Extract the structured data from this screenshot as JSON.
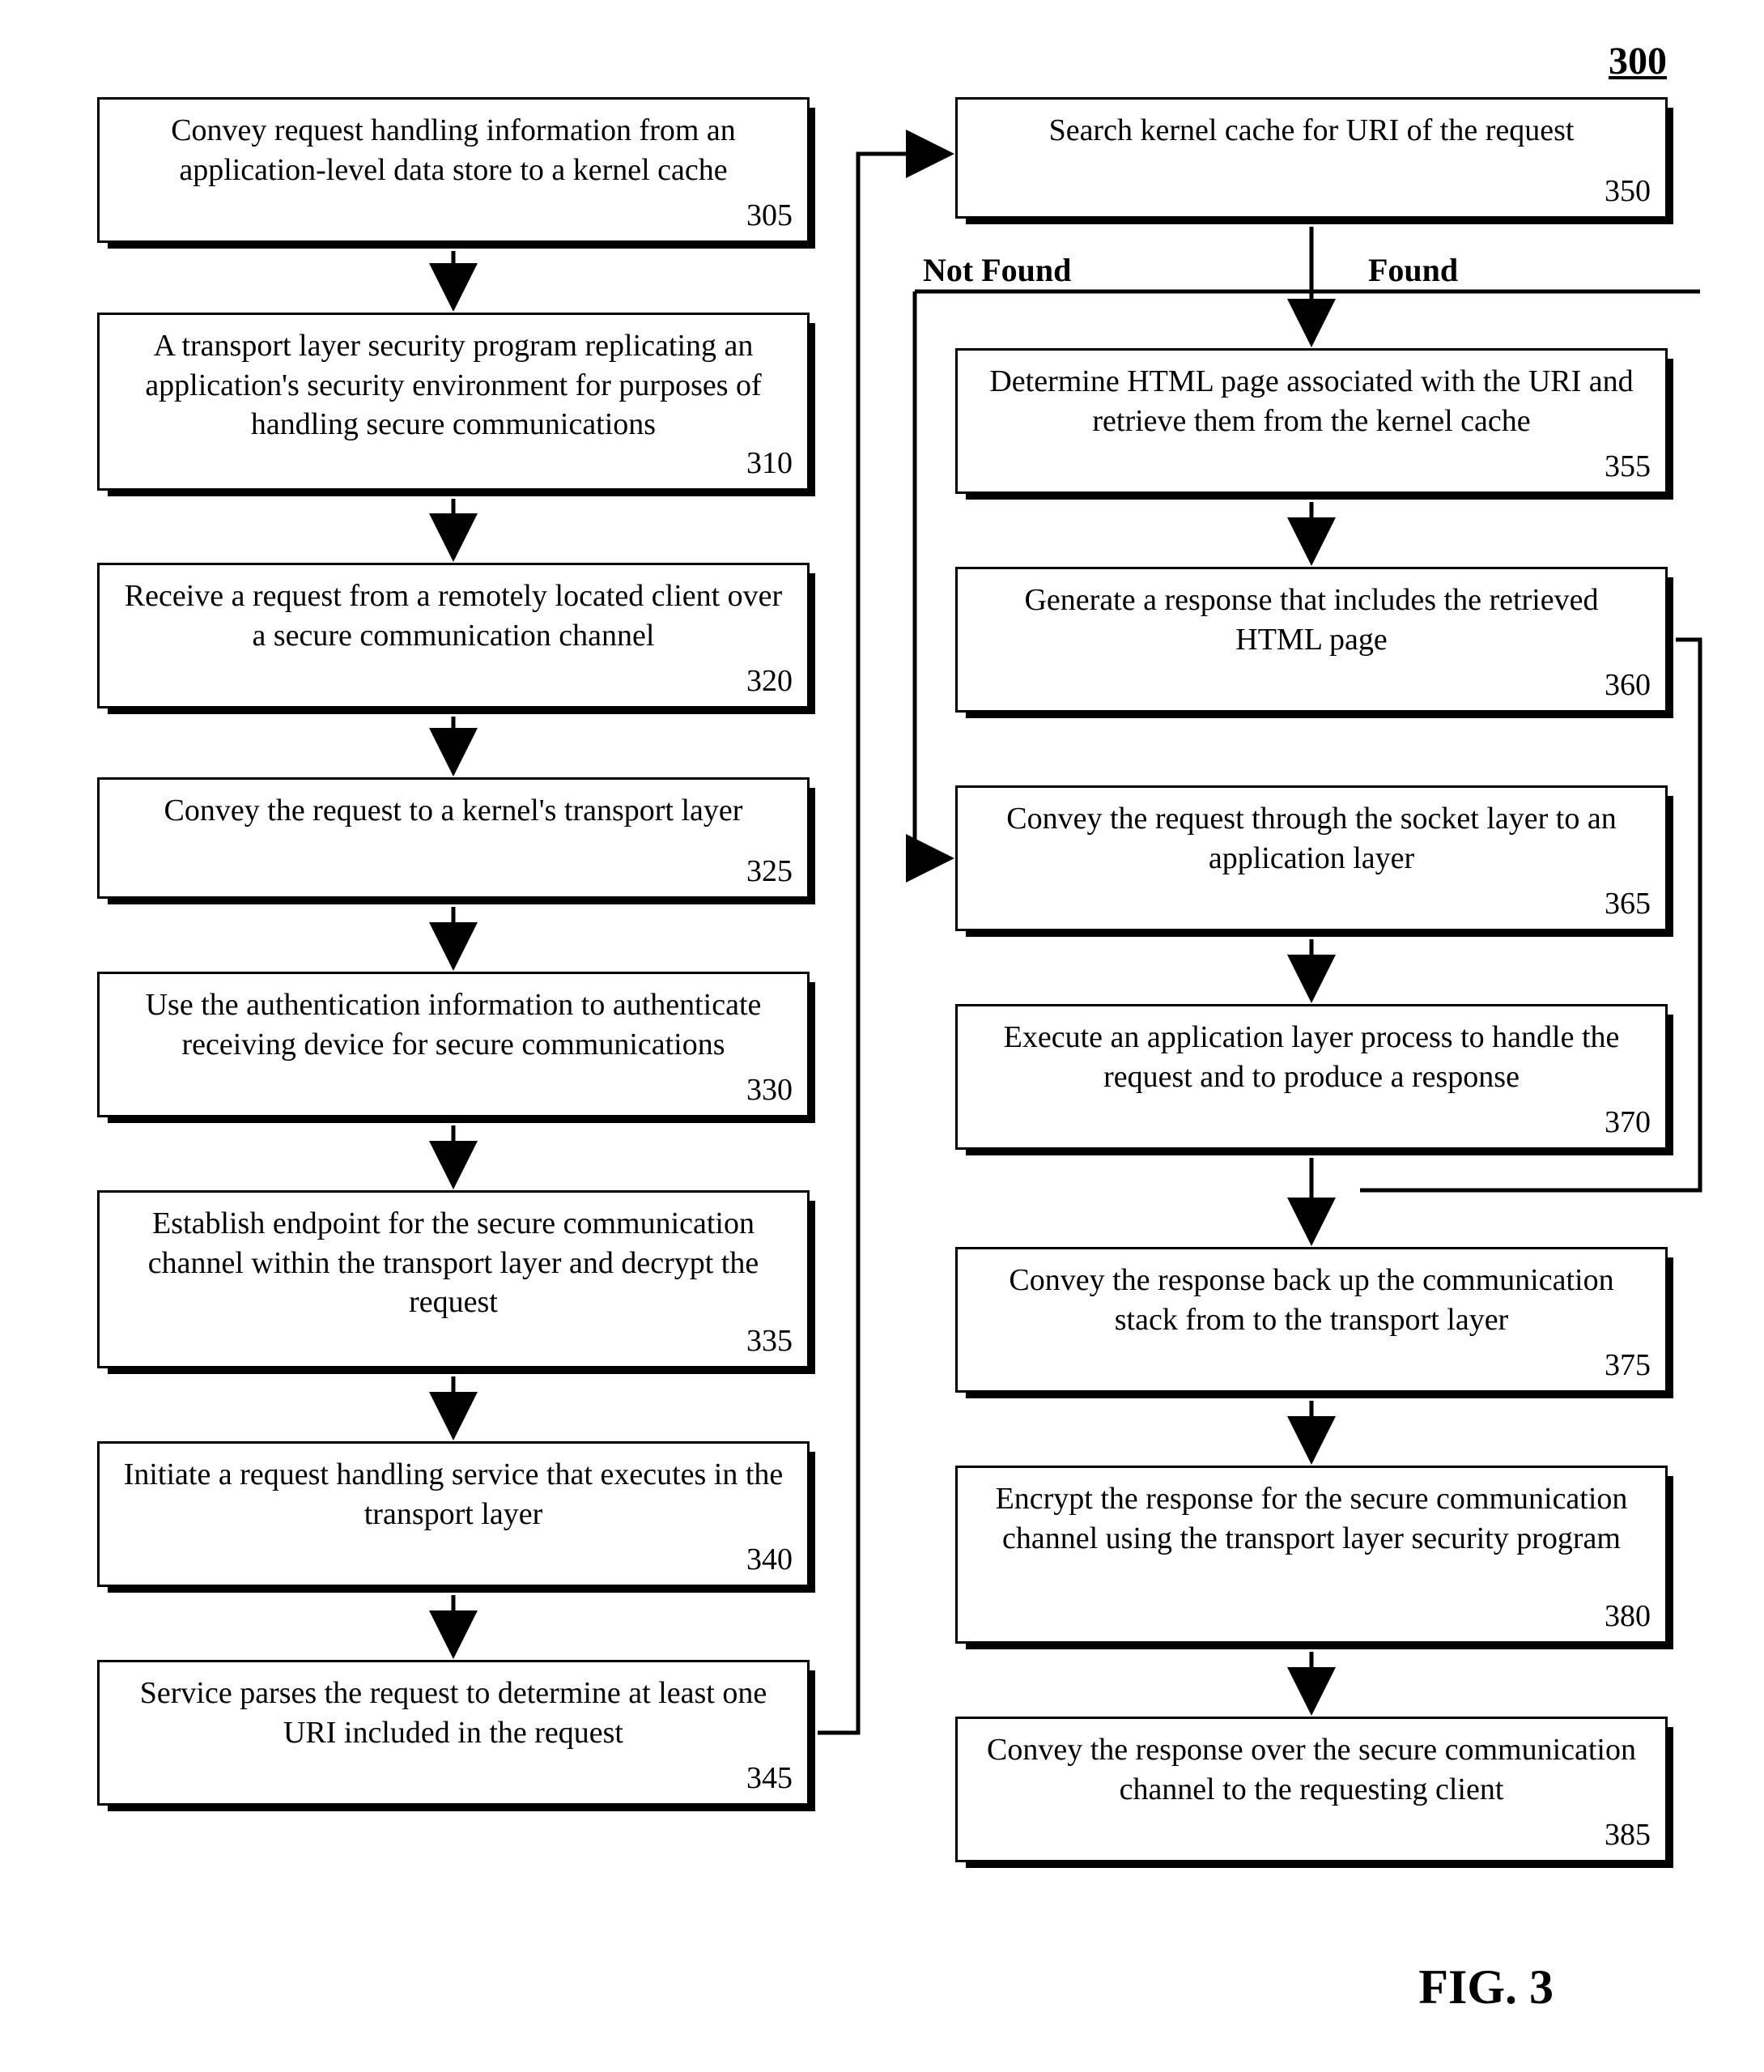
{
  "page_number": "300",
  "figure_caption": "FIG. 3",
  "decision": {
    "not_found": "Not Found",
    "found": "Found"
  },
  "boxes": {
    "b305": {
      "text": "Convey request handling information from an application-level data store to a kernel cache",
      "num": "305"
    },
    "b310": {
      "text": "A transport layer security program replicating an application's security environment for purposes of handling secure communications",
      "num": "310"
    },
    "b320": {
      "text": "Receive a request from a remotely located client over a secure communication channel",
      "num": "320"
    },
    "b325": {
      "text": "Convey the request to a kernel's transport layer",
      "num": "325"
    },
    "b330": {
      "text": "Use the authentication information to authenticate receiving device for secure communications",
      "num": "330"
    },
    "b335": {
      "text": "Establish endpoint for the secure communication channel within the transport layer and decrypt the request",
      "num": "335"
    },
    "b340": {
      "text": "Initiate a request handling service that executes in the transport layer",
      "num": "340"
    },
    "b345": {
      "text": "Service parses the request to determine at least one URI included in the request",
      "num": "345"
    },
    "b350": {
      "text": "Search kernel cache for URI of the request",
      "num": "350"
    },
    "b355": {
      "text": "Determine HTML page associated with the URI and retrieve them from the kernel cache",
      "num": "355"
    },
    "b360": {
      "text": "Generate a response that includes the retrieved HTML page",
      "num": "360"
    },
    "b365": {
      "text": "Convey the request through the socket layer to an application layer",
      "num": "365"
    },
    "b370": {
      "text": "Execute an application layer process to handle the request and to produce a response",
      "num": "370"
    },
    "b375": {
      "text": "Convey the response back up the communication stack from to the transport layer",
      "num": "375"
    },
    "b380": {
      "text": "Encrypt the response for the secure communication channel using the transport layer security program",
      "num": "380"
    },
    "b385": {
      "text": "Convey the response over the secure communication channel to the requesting client",
      "num": "385"
    }
  }
}
